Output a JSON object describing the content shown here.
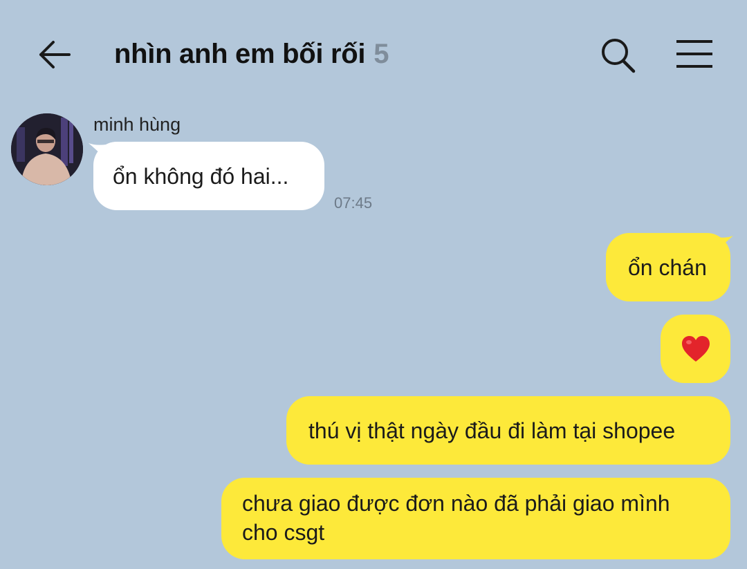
{
  "header": {
    "title": "nhìn anh em bối rối",
    "member_count": "5",
    "back_icon": "arrow-left-icon",
    "search_icon": "search-icon",
    "menu_icon": "hamburger-menu-icon"
  },
  "messages": {
    "incoming": [
      {
        "sender": "minh hùng",
        "text": "ổn không đó hai...",
        "time": "07:45"
      }
    ],
    "outgoing": [
      {
        "text": "ổn chán"
      },
      {
        "text": "❤️"
      },
      {
        "text": "thú vị thật ngày đầu đi làm tại shopee"
      },
      {
        "text": "chưa giao được đơn nào đã phải giao mình cho csgt"
      }
    ]
  },
  "colors": {
    "background": "#b3c7da",
    "outgoing_bubble": "#fde93a",
    "incoming_bubble": "#ffffff",
    "count": "#7f8d9b"
  }
}
